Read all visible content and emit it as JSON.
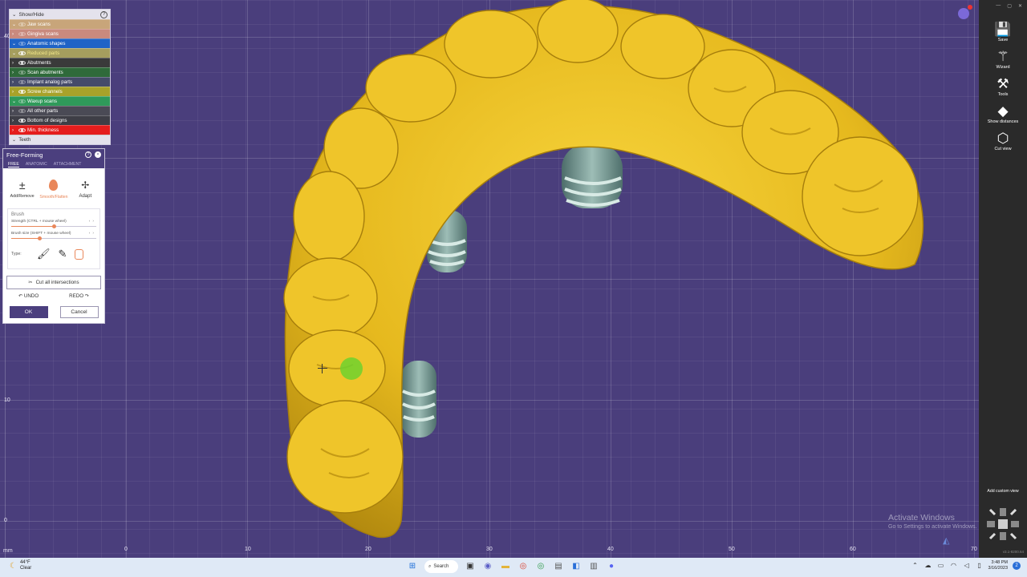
{
  "show_hide": {
    "title": "Show/Hide",
    "layers": [
      {
        "label": "Jaw scans",
        "color": "#c8a57a",
        "expanded": false,
        "visible": false
      },
      {
        "label": "Gingiva scans",
        "color": "#c98a7e",
        "expanded": true,
        "visible": false
      },
      {
        "label": "Anatomic shapes",
        "color": "#1f63c6",
        "expanded": false,
        "visible": false
      },
      {
        "label": "Reduced parts",
        "color": "#a59e5e",
        "expanded": false,
        "visible": true
      },
      {
        "label": "Abutments",
        "color": "#3a3a3a",
        "expanded": true,
        "visible": true
      },
      {
        "label": "Scan abutments",
        "color": "#2f6a3a",
        "expanded": true,
        "visible": false
      },
      {
        "label": "Implant analog parts",
        "color": "#454b6a",
        "expanded": true,
        "visible": false
      },
      {
        "label": "Screw channels",
        "color": "#a8a22a",
        "expanded": true,
        "visible": true
      },
      {
        "label": "Waxup scans",
        "color": "#2f9a5a",
        "expanded": false,
        "visible": false
      },
      {
        "label": "All other parts",
        "color": "#4a4a55",
        "expanded": true,
        "visible": false
      },
      {
        "label": "Bottom of designs",
        "color": "#3e3e46",
        "expanded": true,
        "visible": true
      },
      {
        "label": "Min. thickness",
        "color": "#e51d1d",
        "expanded": true,
        "visible": true
      }
    ],
    "teeth_label": "Teeth"
  },
  "free_forming": {
    "title": "Free-Forming",
    "tabs": [
      "FREE",
      "ANATOMIC",
      "ATTACHMENT"
    ],
    "active_tab": "FREE",
    "tools": [
      {
        "label": "Add/Remove",
        "icon": "plus-minus-icon"
      },
      {
        "label": "Smooth/Flatten",
        "icon": "drop-icon"
      },
      {
        "label": "Adapt",
        "icon": "adapt-icon"
      }
    ],
    "active_tool": "Smooth/Flatten",
    "brush_label": "Brush",
    "strength_label": "Strength (CTRL + mouse wheel)",
    "strength_value": 0.5,
    "size_label": "Brush size (SHIFT + mouse wheel)",
    "size_value": 0.33,
    "type_label": "Type:",
    "cut_label": "Cut all intersections",
    "undo_label": "UNDO",
    "redo_label": "REDO",
    "ok_label": "OK",
    "cancel_label": "Cancel"
  },
  "viewport": {
    "x_ticks": [
      "0",
      "10",
      "20",
      "30",
      "40",
      "50",
      "60",
      "70"
    ],
    "y_ticks": [
      "40",
      "10",
      "0"
    ],
    "unit_label": "mm",
    "restoration_color": "#e8bf22",
    "brush_color": "#6fd12e"
  },
  "right_toolbar": {
    "items": [
      {
        "label": "Save",
        "icon": "save-icon"
      },
      {
        "label": "Wizard",
        "icon": "wizard-icon"
      },
      {
        "label": "Tools",
        "icon": "tools-icon"
      },
      {
        "label": "Show distances",
        "icon": "distance-icon"
      },
      {
        "label": "Cut view",
        "icon": "cut-view-icon"
      }
    ],
    "custom_view_label": "Add custom view",
    "version": "v3.1-8200.64",
    "notification_count": "1"
  },
  "activation": {
    "line1": "Activate Windows",
    "line2": "Go to Settings to activate Windows."
  },
  "taskbar": {
    "temperature": "44°F",
    "condition": "Clear",
    "search_label": "Search",
    "time": "3:48 PM",
    "date": "3/16/2023",
    "badge": "2"
  }
}
